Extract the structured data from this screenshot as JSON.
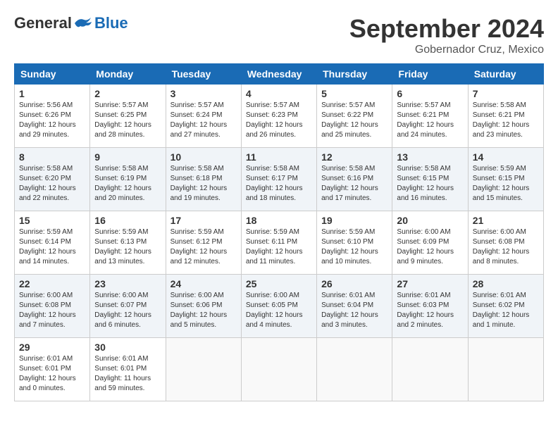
{
  "header": {
    "logo_general": "General",
    "logo_blue": "Blue",
    "month": "September 2024",
    "location": "Gobernador Cruz, Mexico"
  },
  "days_of_week": [
    "Sunday",
    "Monday",
    "Tuesday",
    "Wednesday",
    "Thursday",
    "Friday",
    "Saturday"
  ],
  "weeks": [
    [
      {
        "day": "1",
        "info": "Sunrise: 5:56 AM\nSunset: 6:26 PM\nDaylight: 12 hours and 29 minutes."
      },
      {
        "day": "2",
        "info": "Sunrise: 5:57 AM\nSunset: 6:25 PM\nDaylight: 12 hours and 28 minutes."
      },
      {
        "day": "3",
        "info": "Sunrise: 5:57 AM\nSunset: 6:24 PM\nDaylight: 12 hours and 27 minutes."
      },
      {
        "day": "4",
        "info": "Sunrise: 5:57 AM\nSunset: 6:23 PM\nDaylight: 12 hours and 26 minutes."
      },
      {
        "day": "5",
        "info": "Sunrise: 5:57 AM\nSunset: 6:22 PM\nDaylight: 12 hours and 25 minutes."
      },
      {
        "day": "6",
        "info": "Sunrise: 5:57 AM\nSunset: 6:21 PM\nDaylight: 12 hours and 24 minutes."
      },
      {
        "day": "7",
        "info": "Sunrise: 5:58 AM\nSunset: 6:21 PM\nDaylight: 12 hours and 23 minutes."
      }
    ],
    [
      {
        "day": "8",
        "info": "Sunrise: 5:58 AM\nSunset: 6:20 PM\nDaylight: 12 hours and 22 minutes."
      },
      {
        "day": "9",
        "info": "Sunrise: 5:58 AM\nSunset: 6:19 PM\nDaylight: 12 hours and 20 minutes."
      },
      {
        "day": "10",
        "info": "Sunrise: 5:58 AM\nSunset: 6:18 PM\nDaylight: 12 hours and 19 minutes."
      },
      {
        "day": "11",
        "info": "Sunrise: 5:58 AM\nSunset: 6:17 PM\nDaylight: 12 hours and 18 minutes."
      },
      {
        "day": "12",
        "info": "Sunrise: 5:58 AM\nSunset: 6:16 PM\nDaylight: 12 hours and 17 minutes."
      },
      {
        "day": "13",
        "info": "Sunrise: 5:58 AM\nSunset: 6:15 PM\nDaylight: 12 hours and 16 minutes."
      },
      {
        "day": "14",
        "info": "Sunrise: 5:59 AM\nSunset: 6:15 PM\nDaylight: 12 hours and 15 minutes."
      }
    ],
    [
      {
        "day": "15",
        "info": "Sunrise: 5:59 AM\nSunset: 6:14 PM\nDaylight: 12 hours and 14 minutes."
      },
      {
        "day": "16",
        "info": "Sunrise: 5:59 AM\nSunset: 6:13 PM\nDaylight: 12 hours and 13 minutes."
      },
      {
        "day": "17",
        "info": "Sunrise: 5:59 AM\nSunset: 6:12 PM\nDaylight: 12 hours and 12 minutes."
      },
      {
        "day": "18",
        "info": "Sunrise: 5:59 AM\nSunset: 6:11 PM\nDaylight: 12 hours and 11 minutes."
      },
      {
        "day": "19",
        "info": "Sunrise: 5:59 AM\nSunset: 6:10 PM\nDaylight: 12 hours and 10 minutes."
      },
      {
        "day": "20",
        "info": "Sunrise: 6:00 AM\nSunset: 6:09 PM\nDaylight: 12 hours and 9 minutes."
      },
      {
        "day": "21",
        "info": "Sunrise: 6:00 AM\nSunset: 6:08 PM\nDaylight: 12 hours and 8 minutes."
      }
    ],
    [
      {
        "day": "22",
        "info": "Sunrise: 6:00 AM\nSunset: 6:08 PM\nDaylight: 12 hours and 7 minutes."
      },
      {
        "day": "23",
        "info": "Sunrise: 6:00 AM\nSunset: 6:07 PM\nDaylight: 12 hours and 6 minutes."
      },
      {
        "day": "24",
        "info": "Sunrise: 6:00 AM\nSunset: 6:06 PM\nDaylight: 12 hours and 5 minutes."
      },
      {
        "day": "25",
        "info": "Sunrise: 6:00 AM\nSunset: 6:05 PM\nDaylight: 12 hours and 4 minutes."
      },
      {
        "day": "26",
        "info": "Sunrise: 6:01 AM\nSunset: 6:04 PM\nDaylight: 12 hours and 3 minutes."
      },
      {
        "day": "27",
        "info": "Sunrise: 6:01 AM\nSunset: 6:03 PM\nDaylight: 12 hours and 2 minutes."
      },
      {
        "day": "28",
        "info": "Sunrise: 6:01 AM\nSunset: 6:02 PM\nDaylight: 12 hours and 1 minute."
      }
    ],
    [
      {
        "day": "29",
        "info": "Sunrise: 6:01 AM\nSunset: 6:01 PM\nDaylight: 12 hours and 0 minutes."
      },
      {
        "day": "30",
        "info": "Sunrise: 6:01 AM\nSunset: 6:01 PM\nDaylight: 11 hours and 59 minutes."
      },
      {
        "day": "",
        "info": ""
      },
      {
        "day": "",
        "info": ""
      },
      {
        "day": "",
        "info": ""
      },
      {
        "day": "",
        "info": ""
      },
      {
        "day": "",
        "info": ""
      }
    ]
  ]
}
